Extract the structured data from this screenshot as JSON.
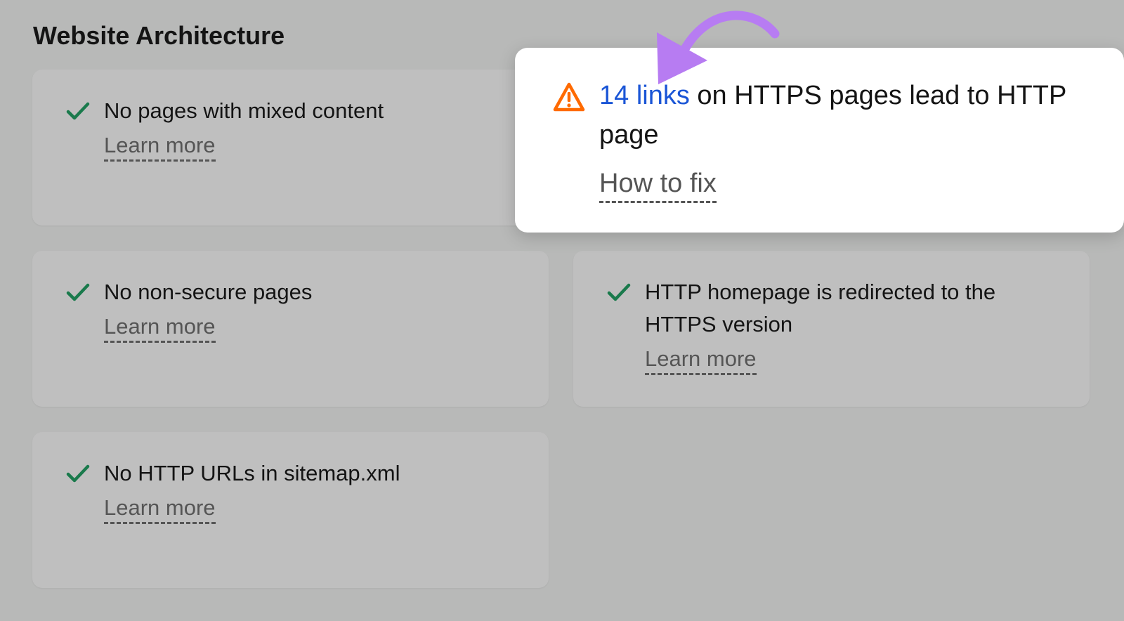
{
  "section": {
    "title": "Website Architecture"
  },
  "cards": [
    {
      "text": "No pages with mixed content",
      "link": "Learn more",
      "icon": "check-icon"
    },
    {
      "text": "No non-secure pages",
      "link": "Learn more",
      "icon": "check-icon"
    },
    {
      "text": "HTTP homepage is redirected to the HTTPS version",
      "link": "Learn more",
      "icon": "check-icon"
    },
    {
      "text": "No HTTP URLs in sitemap.xml",
      "link": "Learn more",
      "icon": "check-icon"
    }
  ],
  "popup": {
    "icon": "warning-icon",
    "link_text": "14 links",
    "message_rest": " on HTTPS pages lead to HTTP page",
    "fix_label": "How to fix"
  },
  "colors": {
    "background": "#b8b9b8",
    "card": "#bfbfbf",
    "check": "#1a7a4c",
    "warning": "#ff6a00",
    "link": "#1a55d6",
    "arrow": "#b77cf2"
  }
}
